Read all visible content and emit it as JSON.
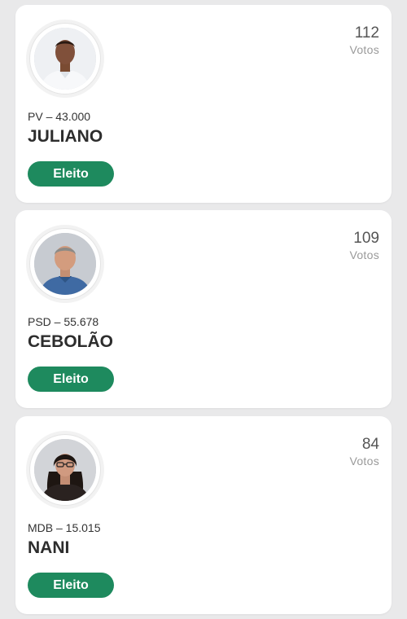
{
  "theme": {
    "elected_color": "#1e8a5e"
  },
  "candidates": [
    {
      "votes": "112",
      "votes_label": "Votos",
      "party_number": "PV – 43.000",
      "name": "JULIANO",
      "status": "Eleito",
      "avatar_icon": "candidate-photo-juliano"
    },
    {
      "votes": "109",
      "votes_label": "Votos",
      "party_number": "PSD – 55.678",
      "name": "CEBOLÃO",
      "status": "Eleito",
      "avatar_icon": "candidate-photo-cebolao"
    },
    {
      "votes": "84",
      "votes_label": "Votos",
      "party_number": "MDB – 15.015",
      "name": "NANI",
      "status": "Eleito",
      "avatar_icon": "candidate-photo-nani"
    }
  ]
}
